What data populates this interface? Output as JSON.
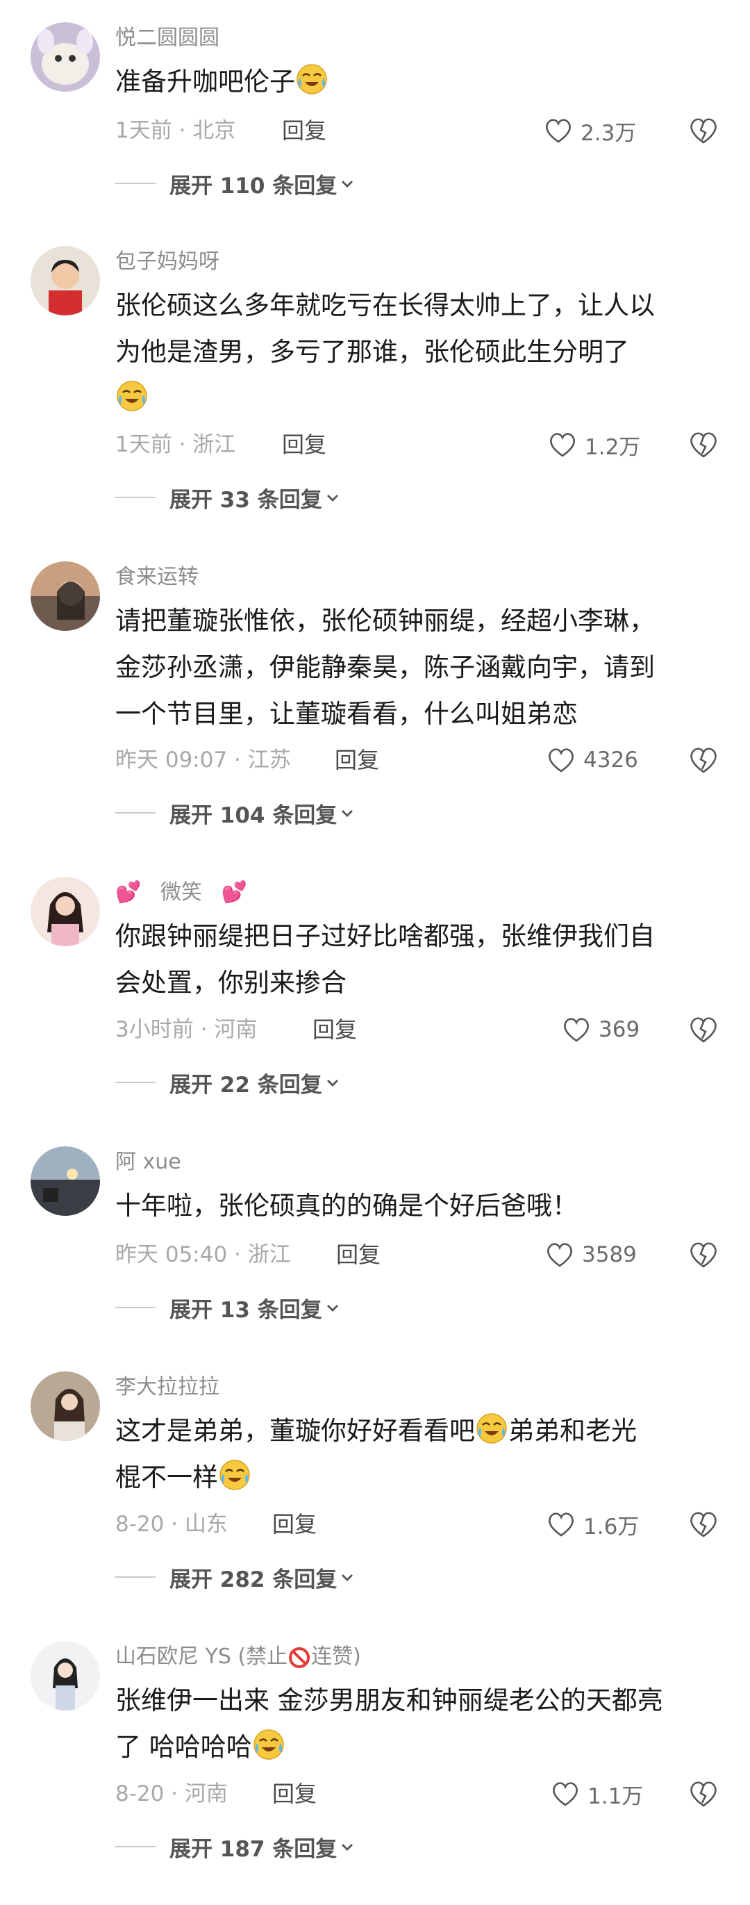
{
  "comments": [
    {
      "username": "悦二圆圆圆",
      "text_lines": [
        "准备升咖吧伦子"
      ],
      "trailing_emoji": "crying-laughing-emoji",
      "time": "1天前",
      "location": "北京",
      "reply_label": "回复",
      "likes": "2.3万",
      "expand": {
        "prefix": "展开",
        "count": "110",
        "suffix": "条回复"
      }
    },
    {
      "username": "包子妈妈呀",
      "text_lines": [
        "张伦硕这么多年就吃亏在长得太帅上了，让人以",
        "为他是渣男，多亏了那谁，张伦硕此生分明了"
      ],
      "third_line_emoji": "laughing-tears-emoji",
      "time": "1天前",
      "location": "浙江",
      "reply_label": "回复",
      "likes": "1.2万",
      "expand": {
        "prefix": "展开",
        "count": "33",
        "suffix": "条回复"
      }
    },
    {
      "username": "食来运转",
      "text_lines": [
        "请把董璇张惟依，张伦硕钟丽缇，经超小李琳，",
        "金莎孙丞潇，伊能静秦昊，陈子涵戴向宇，请到",
        "一个节目里，让董璇看看，什么叫姐弟恋"
      ],
      "time": "昨天 09:07",
      "location": "江苏",
      "reply_label": "回复",
      "likes": "4326",
      "expand": {
        "prefix": "展开",
        "count": "104",
        "suffix": "条回复"
      }
    },
    {
      "username": "微笑",
      "username_emoji": "💕",
      "text_lines": [
        "你跟钟丽缇把日子过好比啥都强，张维伊我们自",
        "会处置，你别来掺合"
      ],
      "time": "3小时前",
      "location": "河南",
      "reply_label": "回复",
      "likes": "369",
      "expand": {
        "prefix": "展开",
        "count": "22",
        "suffix": "条回复"
      }
    },
    {
      "username": "阿 xue",
      "text_lines": [
        "十年啦，张伦硕真的的确是个好后爸哦！"
      ],
      "time": "昨天 05:40",
      "location": "浙江",
      "reply_label": "回复",
      "likes": "3589",
      "expand": {
        "prefix": "展开",
        "count": "13",
        "suffix": "条回复"
      }
    },
    {
      "username": "李大拉拉拉",
      "text_lines": [
        "这才是弟弟，董璇你好好看看吧",
        "弟弟和老光",
        "棍不一样"
      ],
      "time": "8-20",
      "location": "山东",
      "reply_label": "回复",
      "likes": "1.6万",
      "expand": {
        "prefix": "展开",
        "count": "282",
        "suffix": "条回复"
      }
    },
    {
      "username": "山石欧尼 YS (禁止",
      "username_suffix": "连赞)",
      "text_lines": [
        "张维伊一出来 金莎男朋友和钟丽缇老公的天都亮",
        "了 哈哈哈哈"
      ],
      "time": "8-20",
      "location": "河南",
      "reply_label": "回复",
      "likes": "1.1万",
      "expand": {
        "prefix": "展开",
        "count": "187",
        "suffix": "条回复"
      }
    }
  ],
  "colors": {
    "username": "#8c8c8c",
    "text": "#1a1a1a",
    "meta": "#a8a8a8",
    "expand": "#555555"
  }
}
